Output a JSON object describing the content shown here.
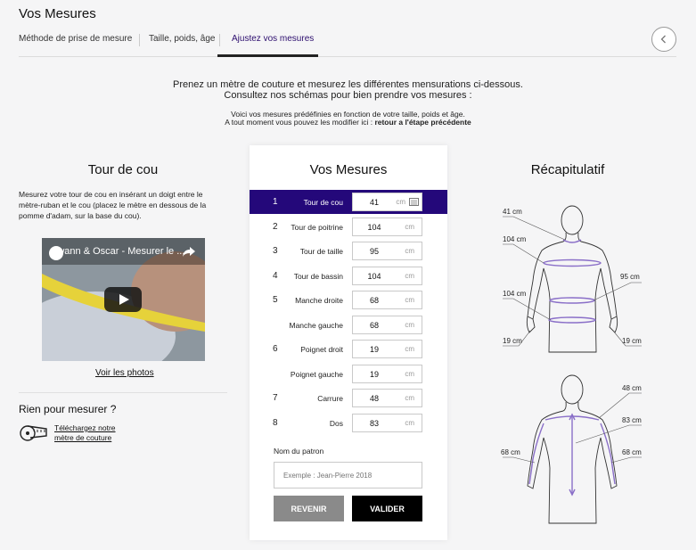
{
  "header": {
    "title": "Vos Mesures",
    "tabs": [
      {
        "label": "Méthode de prise de mesure"
      },
      {
        "label": "Taille, poids, âge"
      },
      {
        "label": "Ajustez vos mesures"
      }
    ],
    "back_icon": "chevron-left-icon"
  },
  "intro": {
    "line1": "Prenez un mètre de couture et mesurez les différentes mensurations ci-dessous.",
    "line2": "Consultez nos schémas pour bien prendre vos mesures :",
    "line3": "Voici vos mesures prédéfinies en fonction de votre taille, poids et âge.",
    "line4_prefix": "A tout moment vous pouvez les modifier ici : ",
    "line4_link": "retour a l'étape précédente"
  },
  "left": {
    "title": "Tour de cou",
    "description": "Mesurez votre tour de cou en insérant un doigt entre le mètre-ruban et le cou (placez le mètre en dessous de la pomme d'adam, sur la base du cou).",
    "video_title": "Swann & Oscar - Mesurer le ...",
    "photos_link": "Voir les photos",
    "no_tape_title": "Rien pour mesurer ?",
    "download_line1": "Téléchargez notre",
    "download_line2": "mètre de couture"
  },
  "form": {
    "title": "Vos Mesures",
    "unit": "cm",
    "rows": [
      {
        "num": "1",
        "label": "Tour de cou",
        "value": "41"
      },
      {
        "num": "2",
        "label": "Tour de poitrine",
        "value": "104"
      },
      {
        "num": "3",
        "label": "Tour de taille",
        "value": "95"
      },
      {
        "num": "4",
        "label": "Tour de bassin",
        "value": "104"
      },
      {
        "num": "5",
        "label": "Manche droite",
        "value": "68"
      },
      {
        "num": "",
        "label": "Manche gauche",
        "value": "68"
      },
      {
        "num": "6",
        "label": "Poignet droit",
        "value": "19"
      },
      {
        "num": "",
        "label": "Poignet gauche",
        "value": "19"
      },
      {
        "num": "7",
        "label": "Carrure",
        "value": "48"
      },
      {
        "num": "8",
        "label": "Dos",
        "value": "83"
      }
    ],
    "name_label": "Nom du patron",
    "name_placeholder": "Exemple : Jean-Pierre 2018",
    "back_button": "REVENIR",
    "submit_button": "VALIDER"
  },
  "recap": {
    "title": "Récapitulatif",
    "front": {
      "neck": "41 cm",
      "chest": "104 cm",
      "waist": "95 cm",
      "hips": "104 cm",
      "wrist_left": "19 cm",
      "wrist_right": "19 cm"
    },
    "back": {
      "shoulders": "48 cm",
      "back": "83 cm",
      "sleeve_left": "68 cm",
      "sleeve_right": "68 cm"
    }
  },
  "colors": {
    "accent": "#24087a",
    "tape": "#e6d23a"
  }
}
